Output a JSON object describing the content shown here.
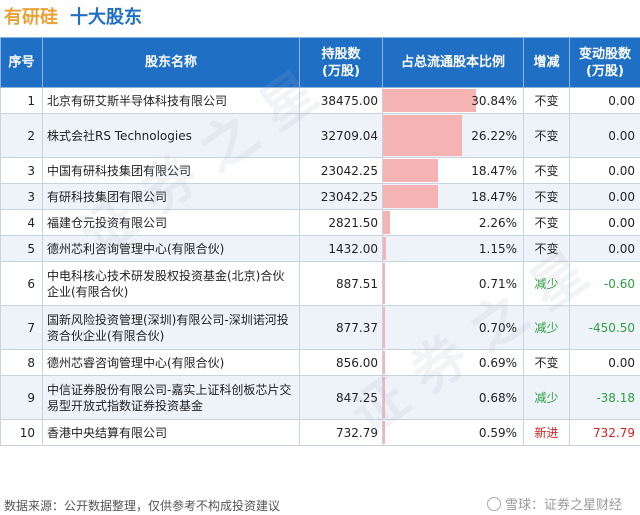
{
  "header": {
    "stock_name": "有研硅",
    "title": "十大股东"
  },
  "columns": [
    "序号",
    "股东名称",
    "持股数\n(万股)",
    "占总流通股本比例",
    "增减",
    "变动股数\n(万股)"
  ],
  "rows": [
    {
      "idx": "1",
      "name": "北京有研艾斯半导体科技有限公司",
      "shares": "38475.00",
      "pct": "30.84%",
      "pct_value": 30.84,
      "change": "不变",
      "change_type": "same",
      "delta": "0.00"
    },
    {
      "idx": "2",
      "name": "株式会社RS Technologies",
      "shares": "32709.04",
      "pct": "26.22%",
      "pct_value": 26.22,
      "change": "不变",
      "change_type": "same",
      "delta": "0.00"
    },
    {
      "idx": "3",
      "name": "中国有研科技集团有限公司",
      "shares": "23042.25",
      "pct": "18.47%",
      "pct_value": 18.47,
      "change": "不变",
      "change_type": "same",
      "delta": "0.00"
    },
    {
      "idx": "3",
      "name": "有研科技集团有限公司",
      "shares": "23042.25",
      "pct": "18.47%",
      "pct_value": 18.47,
      "change": "不变",
      "change_type": "same",
      "delta": "0.00"
    },
    {
      "idx": "4",
      "name": "福建仓元投资有限公司",
      "shares": "2821.50",
      "pct": "2.26%",
      "pct_value": 2.26,
      "change": "不变",
      "change_type": "same",
      "delta": "0.00"
    },
    {
      "idx": "5",
      "name": "德州芯利咨询管理中心(有限合伙)",
      "shares": "1432.00",
      "pct": "1.15%",
      "pct_value": 1.15,
      "change": "不变",
      "change_type": "same",
      "delta": "0.00"
    },
    {
      "idx": "6",
      "name": "中电科核心技术研发股权投资基金(北京)合伙企业(有限合伙)",
      "shares": "887.51",
      "pct": "0.71%",
      "pct_value": 0.71,
      "change": "减少",
      "change_type": "down",
      "delta": "-0.60"
    },
    {
      "idx": "7",
      "name": "国新风险投资管理(深圳)有限公司-深圳诺河投资合伙企业(有限合伙)",
      "shares": "877.37",
      "pct": "0.70%",
      "pct_value": 0.7,
      "change": "减少",
      "change_type": "down",
      "delta": "-450.50"
    },
    {
      "idx": "8",
      "name": "德州芯睿咨询管理中心(有限合伙)",
      "shares": "856.00",
      "pct": "0.69%",
      "pct_value": 0.69,
      "change": "不变",
      "change_type": "same",
      "delta": "0.00"
    },
    {
      "idx": "9",
      "name": "中信证券股份有限公司-嘉实上证科创板芯片交易型开放式指数证券投资基金",
      "shares": "847.25",
      "pct": "0.68%",
      "pct_value": 0.68,
      "change": "减少",
      "change_type": "down",
      "delta": "-38.18"
    },
    {
      "idx": "10",
      "name": "香港中央结算有限公司",
      "shares": "732.79",
      "pct": "0.59%",
      "pct_value": 0.59,
      "change": "新进",
      "change_type": "new",
      "delta": "732.79"
    }
  ],
  "colors": {
    "header_bg": "#1f6fc5",
    "bar": "#f5b3b3",
    "down": "#2e9e3f",
    "new": "#d6201e"
  },
  "footer": "数据来源：公开数据整理，仅供参考不构成投资建议",
  "brand": "雪球：证券之星财经"
}
